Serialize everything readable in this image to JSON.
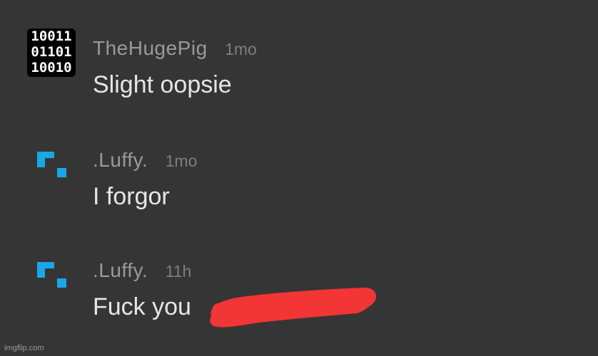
{
  "comments": [
    {
      "username": "TheHugePig",
      "timestamp": "1mo",
      "text": "Slight oopsie",
      "avatar": {
        "type": "binary-grid",
        "rows": [
          "10011",
          "01101",
          "10010"
        ]
      }
    },
    {
      "username": ".Luffy.",
      "timestamp": "1mo",
      "text": "I forgor",
      "avatar": {
        "type": "pixel-icon",
        "color": "#1aa7e8"
      }
    },
    {
      "username": ".Luffy.",
      "timestamp": "11h",
      "text": "Fuck you",
      "avatar": {
        "type": "pixel-icon",
        "color": "#1aa7e8"
      }
    }
  ],
  "redaction": {
    "color": "#f23535"
  },
  "watermark": "imgflip.com"
}
